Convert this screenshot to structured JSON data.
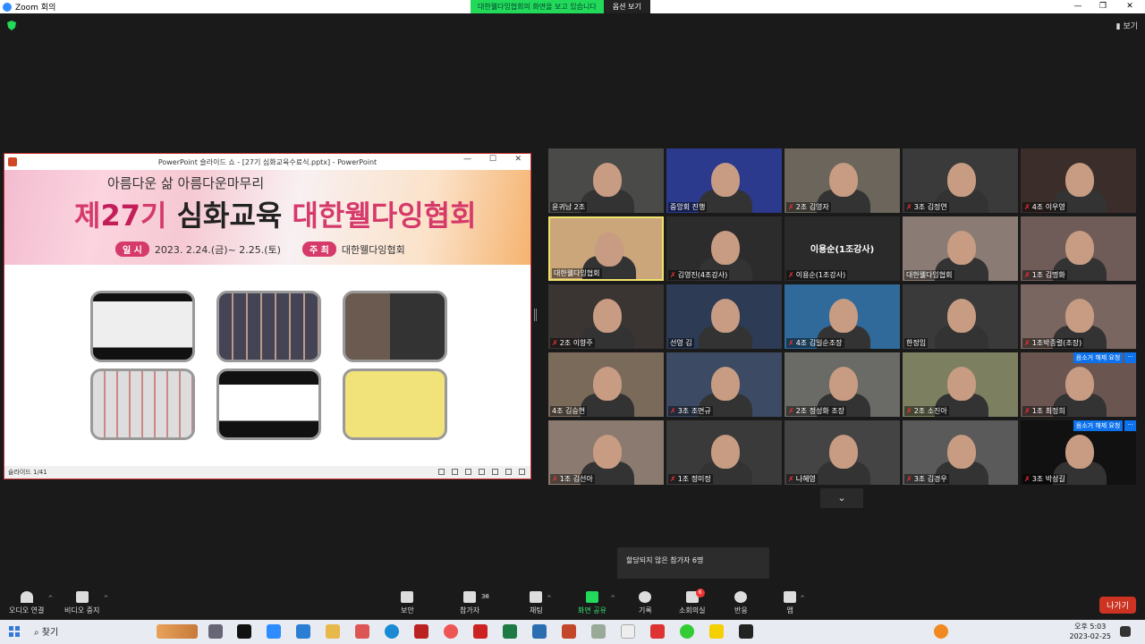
{
  "window": {
    "title": "Zoom 회의",
    "minimize": "—",
    "restore": "❐",
    "close": "✕"
  },
  "share_banner": {
    "status": "대한웰다잉협회의 화면을 보고 있습니다",
    "options": "옵션 보기"
  },
  "view_button": "보기",
  "powerpoint": {
    "title": "PowerPoint 슬라이드 쇼 - [27기 심화교육수료식.pptx] - PowerPoint",
    "slide": {
      "subtitle": "아름다운 삶 아름다운마무리",
      "headline_prefix": "제",
      "headline_num": "27",
      "headline_gi": "기 ",
      "headline_main": "심화교육",
      "headline_org": " 대한웰다잉협회",
      "date_label": "일 시",
      "date_value": "2023. 2.24.(금)~ 2.25.(토)",
      "host_label": "주 최",
      "host_value": "대한웰다잉협회"
    },
    "status": "슬라이드 1/41"
  },
  "participants": [
    {
      "name": "윤귀남 2조",
      "muted": false
    },
    {
      "name": "중앙회 진행",
      "muted": false
    },
    {
      "name": "2조 김영자",
      "muted": true
    },
    {
      "name": "3조 김정연",
      "muted": true
    },
    {
      "name": "4조 이우영",
      "muted": true
    },
    {
      "name": "대한웰다잉협회",
      "muted": false
    },
    {
      "name": "김영진(4조강사)",
      "muted": true
    },
    {
      "name": "이용순(1조강사)",
      "muted": true,
      "center": "이용순(1조강사)"
    },
    {
      "name": "대한웰다잉협회",
      "muted": false
    },
    {
      "name": "1조 김명화",
      "muted": true
    },
    {
      "name": "2조 이향주",
      "muted": true
    },
    {
      "name": "선영 김",
      "muted": false
    },
    {
      "name": "4조 김일순조장",
      "muted": true
    },
    {
      "name": "한정임",
      "muted": false
    },
    {
      "name": "1조박종렬(조장)",
      "muted": true
    },
    {
      "name": "4조 김승현",
      "muted": false
    },
    {
      "name": "3조 조면규",
      "muted": true
    },
    {
      "name": "2조 정성화 조장",
      "muted": true
    },
    {
      "name": "2조 소진아",
      "muted": true
    },
    {
      "name": "1조 최정희",
      "muted": true,
      "unmute_request": "음소거 해제 요청"
    },
    {
      "name": "1조 김선아",
      "muted": true
    },
    {
      "name": "1조 정미정",
      "muted": true
    },
    {
      "name": "나혜영",
      "muted": true
    },
    {
      "name": "3조 김경우",
      "muted": true
    },
    {
      "name": "3조 박성길",
      "muted": true,
      "unmute_request": "음소거 해제 요청"
    }
  ],
  "gallery_next": "⌄",
  "toast": "할당되지 않은 참가자 6명",
  "toolbar": {
    "audio": "오디오 연결",
    "video": "비디오 중지",
    "security": "보안",
    "participants": "참가자",
    "participants_count": "38",
    "chat": "채팅",
    "share": "화면 공유",
    "record": "기록",
    "breakout": "소회의실",
    "breakout_badge": "6",
    "reactions": "반응",
    "apps": "앱",
    "leave": "나가기"
  },
  "taskbar": {
    "search": "찾기",
    "time": "오후 5:03",
    "date": "2023-02-25"
  },
  "colors": {
    "share_green": "#23d959",
    "leave_red": "#cc3322",
    "active_speaker": "#f0e36a",
    "unmute_blue": "#0e72ed"
  }
}
